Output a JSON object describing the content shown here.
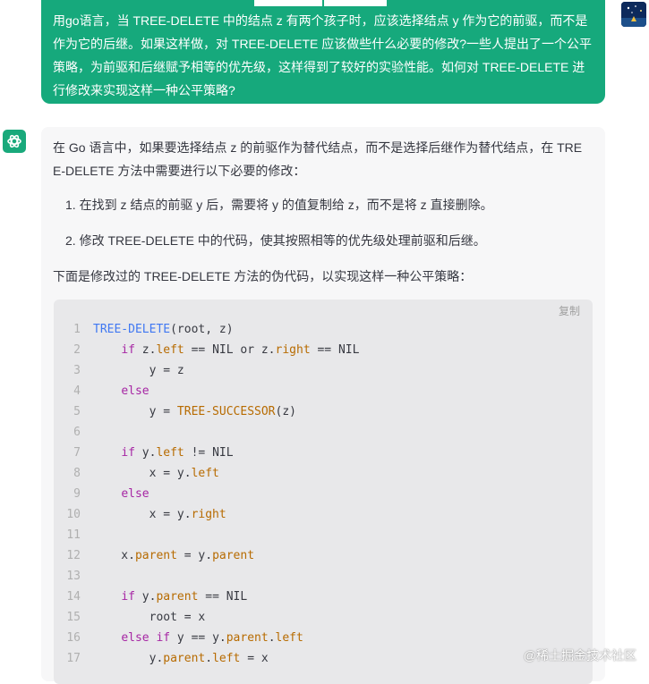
{
  "user_message": {
    "lines": [
      "用go语言，当 TREE-DELETE 中的结点 z 有两个孩子时，应该选择结点 y 作为它的前驱，而不是",
      "作为它的后继。如果这样做，对 TREE-DELETE 应该做些什么必要的修改?一些人提出了一个公平",
      "策略，为前驱和后继赋予相等的优先级，这样得到了较好的实验性能。如何对 TREE-DELETE 进",
      "行修改来实现这样一种公平策略?"
    ]
  },
  "answer": {
    "intro_lines": [
      "在 Go 语言中，如果要选择结点 z 的前驱作为替代结点，而不是选择后继作为替代结点，在 TRE",
      "E-DELETE 方法中需要进行以下必要的修改："
    ],
    "list_items": [
      "1. 在找到 z 结点的前驱 y 后，需要将 y 的值复制给 z，而不是将 z 直接删除。",
      "2. 修改 TREE-DELETE 中的代码，使其按照相等的优先级处理前驱和后继。"
    ],
    "code_intro": "下面是修改过的 TREE-DELETE 方法的伪代码，以实现这样一种公平策略：",
    "copy_label": "复制",
    "code": [
      {
        "n": "1",
        "t": [
          {
            "c": "f",
            "s": "TREE-DELETE"
          },
          {
            "c": "p",
            "s": "(root, z)"
          }
        ]
      },
      {
        "n": "2",
        "t": [
          {
            "c": "p",
            "s": "    "
          },
          {
            "c": "k",
            "s": "if"
          },
          {
            "c": "p",
            "s": " z."
          },
          {
            "c": "a",
            "s": "left"
          },
          {
            "c": "p",
            "s": " == NIL or z."
          },
          {
            "c": "a",
            "s": "right"
          },
          {
            "c": "p",
            "s": " == NIL"
          }
        ]
      },
      {
        "n": "3",
        "t": [
          {
            "c": "p",
            "s": "        y = z"
          }
        ]
      },
      {
        "n": "4",
        "t": [
          {
            "c": "p",
            "s": "    "
          },
          {
            "c": "k",
            "s": "else"
          }
        ]
      },
      {
        "n": "5",
        "t": [
          {
            "c": "p",
            "s": "        y = "
          },
          {
            "c": "a",
            "s": "TREE-SUCCESSOR"
          },
          {
            "c": "p",
            "s": "(z)"
          }
        ]
      },
      {
        "n": "6",
        "t": []
      },
      {
        "n": "7",
        "t": [
          {
            "c": "p",
            "s": "    "
          },
          {
            "c": "k",
            "s": "if"
          },
          {
            "c": "p",
            "s": " y."
          },
          {
            "c": "a",
            "s": "left"
          },
          {
            "c": "p",
            "s": " != NIL"
          }
        ]
      },
      {
        "n": "8",
        "t": [
          {
            "c": "p",
            "s": "        x = y."
          },
          {
            "c": "a",
            "s": "left"
          }
        ]
      },
      {
        "n": "9",
        "t": [
          {
            "c": "p",
            "s": "    "
          },
          {
            "c": "k",
            "s": "else"
          }
        ]
      },
      {
        "n": "10",
        "t": [
          {
            "c": "p",
            "s": "        x = y."
          },
          {
            "c": "a",
            "s": "right"
          }
        ]
      },
      {
        "n": "11",
        "t": []
      },
      {
        "n": "12",
        "t": [
          {
            "c": "p",
            "s": "    x."
          },
          {
            "c": "a",
            "s": "parent"
          },
          {
            "c": "p",
            "s": " = y."
          },
          {
            "c": "a",
            "s": "parent"
          }
        ]
      },
      {
        "n": "13",
        "t": []
      },
      {
        "n": "14",
        "t": [
          {
            "c": "p",
            "s": "    "
          },
          {
            "c": "k",
            "s": "if"
          },
          {
            "c": "p",
            "s": " y."
          },
          {
            "c": "a",
            "s": "parent"
          },
          {
            "c": "p",
            "s": " == NIL"
          }
        ]
      },
      {
        "n": "15",
        "t": [
          {
            "c": "p",
            "s": "        root = x"
          }
        ]
      },
      {
        "n": "16",
        "t": [
          {
            "c": "p",
            "s": "    "
          },
          {
            "c": "k",
            "s": "else if"
          },
          {
            "c": "p",
            "s": " y == y."
          },
          {
            "c": "a",
            "s": "parent"
          },
          {
            "c": "p",
            "s": "."
          },
          {
            "c": "a",
            "s": "left"
          }
        ]
      },
      {
        "n": "17",
        "t": [
          {
            "c": "p",
            "s": "        y."
          },
          {
            "c": "a",
            "s": "parent"
          },
          {
            "c": "p",
            "s": "."
          },
          {
            "c": "a",
            "s": "left"
          },
          {
            "c": "p",
            "s": " = x"
          }
        ]
      }
    ]
  },
  "watermark": "@稀土掘金技术社区",
  "icons": {
    "bot": "openai-logo-icon",
    "avatar": "user-avatar-night-sky"
  },
  "colors": {
    "user_bubble": "#16a97c",
    "code_bg": "#e8e8ea",
    "keyword": "#a626a4",
    "function": "#4078f2",
    "attribute": "#b76b01",
    "plain": "#383a42"
  }
}
